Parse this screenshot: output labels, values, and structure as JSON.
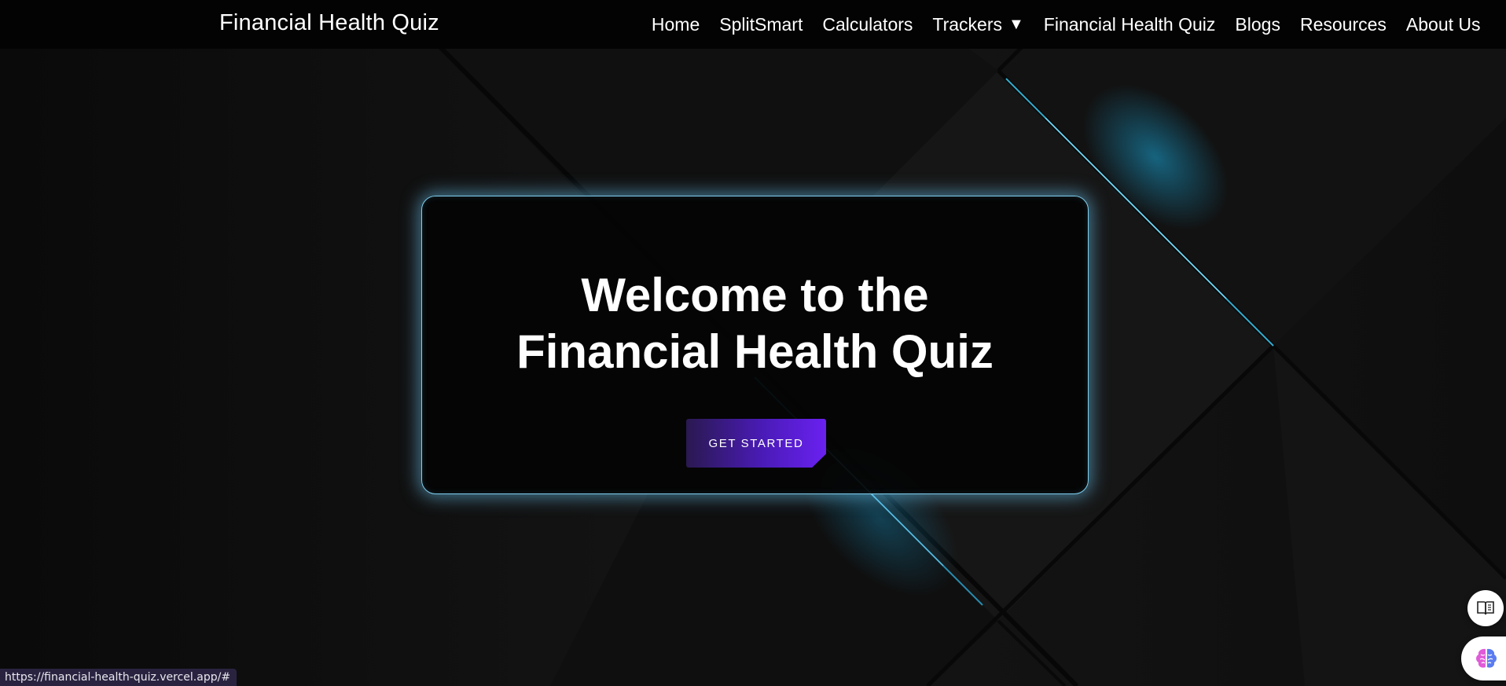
{
  "navbar": {
    "brand": "Financial Health Quiz",
    "links": [
      {
        "label": "Home"
      },
      {
        "label": "SplitSmart"
      },
      {
        "label": "Calculators"
      },
      {
        "label": "Trackers",
        "caret": "▼"
      },
      {
        "label": "Financial Health Quiz"
      },
      {
        "label": "Blogs"
      },
      {
        "label": "Resources"
      },
      {
        "label": "About Us"
      }
    ]
  },
  "hero": {
    "title": "Welcome to the Financial Health Quiz",
    "cta_label": "GET STARTED"
  },
  "floating": {
    "read_icon": "book-icon",
    "brain_icon": "brain-icon"
  },
  "status_bar": {
    "url": "https://financial-health-quiz.vercel.app/#"
  },
  "colors": {
    "accent_glow": "#7fd0f0",
    "cta_start": "#2a1950",
    "cta_end": "#6a21f0",
    "navbar_bg": "#030303"
  }
}
